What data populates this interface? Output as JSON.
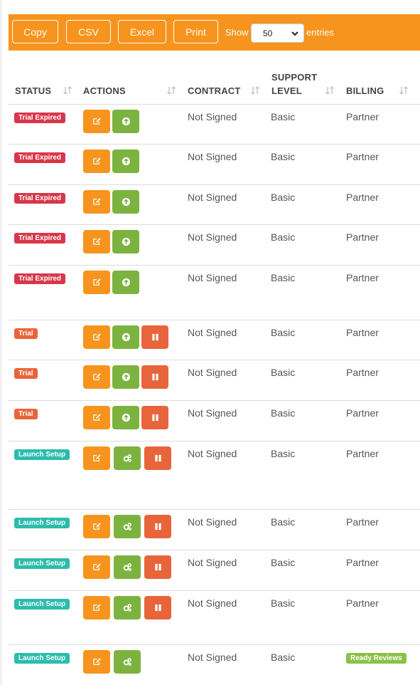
{
  "toolbar": {
    "buttons": [
      "Copy",
      "CSV",
      "Excel",
      "Print"
    ],
    "show_label": "Show",
    "page_size": "50",
    "entries_label": "entries"
  },
  "columns": {
    "status": "STATUS",
    "actions": "ACTIONS",
    "contract": "CONTRACT",
    "support_level_1": "SUPPORT",
    "support_level_2": "LEVEL",
    "billing": "BILLING"
  },
  "rows": [
    {
      "status": "Trial Expired",
      "status_kind": "expired",
      "actions": [
        "edit",
        "upload"
      ],
      "contract": "Not Signed",
      "support": "Basic",
      "billing": "Partner",
      "billing_kind": "text"
    },
    {
      "status": "Trial Expired",
      "status_kind": "expired",
      "actions": [
        "edit",
        "upload"
      ],
      "contract": "Not Signed",
      "support": "Basic",
      "billing": "Partner",
      "billing_kind": "text"
    },
    {
      "status": "Trial Expired",
      "status_kind": "expired",
      "actions": [
        "edit",
        "upload"
      ],
      "contract": "Not Signed",
      "support": "Basic",
      "billing": "Partner",
      "billing_kind": "text"
    },
    {
      "status": "Trial Expired",
      "status_kind": "expired",
      "actions": [
        "edit",
        "upload"
      ],
      "contract": "Not Signed",
      "support": "Basic",
      "billing": "Partner",
      "billing_kind": "text"
    },
    {
      "status": "Trial Expired",
      "status_kind": "expired",
      "actions": [
        "edit",
        "upload"
      ],
      "contract": "Not Signed",
      "support": "Basic",
      "billing": "Partner",
      "billing_kind": "text"
    },
    {
      "status": "Trial",
      "status_kind": "trial",
      "actions": [
        "edit",
        "upload",
        "pause"
      ],
      "contract": "Not Signed",
      "support": "Basic",
      "billing": "Partner",
      "billing_kind": "text"
    },
    {
      "status": "Trial",
      "status_kind": "trial",
      "actions": [
        "edit",
        "upload",
        "pause"
      ],
      "contract": "Not Signed",
      "support": "Basic",
      "billing": "Partner",
      "billing_kind": "text"
    },
    {
      "status": "Trial",
      "status_kind": "trial",
      "actions": [
        "edit",
        "upload",
        "pause"
      ],
      "contract": "Not Signed",
      "support": "Basic",
      "billing": "Partner",
      "billing_kind": "text"
    },
    {
      "status": "Launch Setup",
      "status_kind": "launch",
      "actions": [
        "edit",
        "settings",
        "pause"
      ],
      "contract": "Not Signed",
      "support": "Basic",
      "billing": "Partner",
      "billing_kind": "text"
    },
    {
      "status": "Launch Setup",
      "status_kind": "launch",
      "actions": [
        "edit",
        "settings",
        "pause"
      ],
      "contract": "Not Signed",
      "support": "Basic",
      "billing": "Partner",
      "billing_kind": "text"
    },
    {
      "status": "Launch Setup",
      "status_kind": "launch",
      "actions": [
        "edit",
        "settings",
        "pause"
      ],
      "contract": "Not Signed",
      "support": "Basic",
      "billing": "Partner",
      "billing_kind": "text"
    },
    {
      "status": "Launch Setup",
      "status_kind": "launch",
      "actions": [
        "edit",
        "settings",
        "pause"
      ],
      "contract": "Not Signed",
      "support": "Basic",
      "billing": "Partner",
      "billing_kind": "text"
    },
    {
      "status": "Launch Setup",
      "status_kind": "launch",
      "actions": [
        "edit",
        "settings"
      ],
      "contract": "Not Signed",
      "support": "Basic",
      "billing": "Ready Reviews",
      "billing_kind": "badge"
    }
  ],
  "colors": {
    "accent": "#f7941d",
    "expired": "#d9364a",
    "trial": "#e8643a",
    "launch": "#2bbcac",
    "ready": "#8ac146",
    "green_action": "#7cb33f"
  }
}
